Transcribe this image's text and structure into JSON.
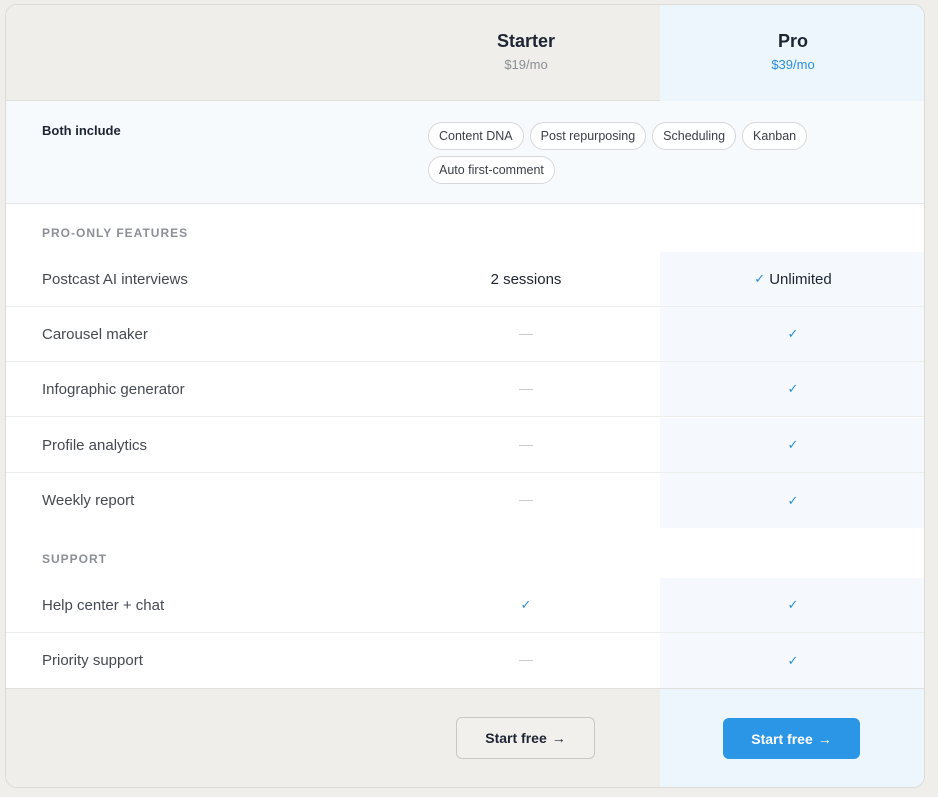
{
  "plans": {
    "starter": {
      "name": "Starter",
      "price": "$19/mo",
      "cta": "Start free",
      "cta_arrow": "→"
    },
    "pro": {
      "name": "Pro",
      "price": "$39/mo",
      "cta": "Start free",
      "cta_arrow": "→"
    }
  },
  "both_include": {
    "label": "Both include",
    "chips": [
      "Content DNA",
      "Post repurposing",
      "Scheduling",
      "Kanban",
      "Auto first-comment"
    ]
  },
  "sections": {
    "pro_only": {
      "title": "PRO-ONLY FEATURES",
      "rows": [
        {
          "label": "Postcast AI interviews",
          "starter": "2 sessions",
          "pro": "Unlimited"
        },
        {
          "label": "Carousel maker",
          "starter": "—",
          "pro": "✓"
        },
        {
          "label": "Infographic generator",
          "starter": "—",
          "pro": "✓"
        },
        {
          "label": "Profile analytics",
          "starter": "—",
          "pro": "✓"
        },
        {
          "label": "Weekly report",
          "starter": "—",
          "pro": "✓"
        }
      ]
    },
    "support": {
      "title": "SUPPORT",
      "rows": [
        {
          "label": "Help center + chat",
          "starter": "✓",
          "pro": "✓"
        },
        {
          "label": "Priority support",
          "starter": "—",
          "pro": "✓"
        }
      ]
    }
  },
  "colors": {
    "accent": "#2b95e6",
    "check": "#2a8ed8",
    "pro_column_bg": "#eef6fd",
    "header_bg": "#efeeea"
  },
  "icons": {
    "check": "check-icon",
    "dash": "dash-icon",
    "arrow": "arrow-right-icon"
  }
}
